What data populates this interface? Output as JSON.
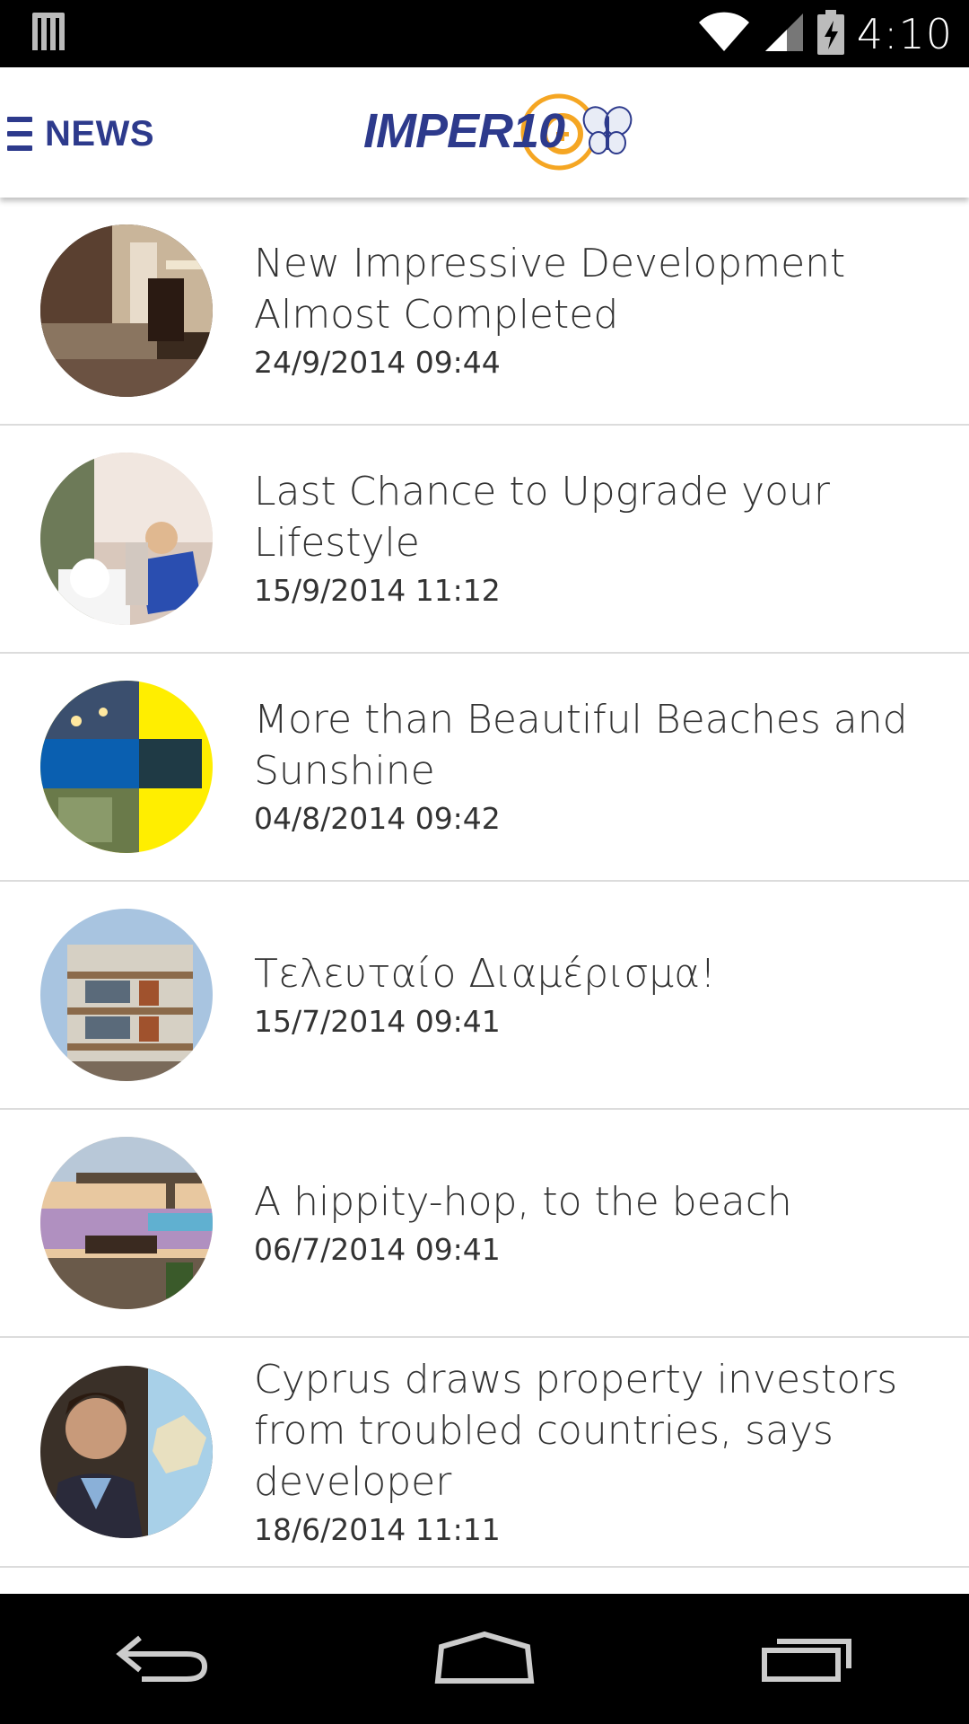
{
  "status_bar": {
    "time": "4:10",
    "icons": [
      "notification-bars-icon",
      "wifi-icon",
      "cell-signal-icon",
      "battery-charging-icon"
    ]
  },
  "app_bar": {
    "menu_label": "NEWS",
    "logo_text": "IMPER10"
  },
  "news": [
    {
      "title": "New Impressive Development Almost Completed",
      "date": "24/9/2014 09:44",
      "thumb": "living-room"
    },
    {
      "title": "Last Chance to Upgrade your Lifestyle",
      "date": "15/9/2014 11:12",
      "thumb": "woman-interior"
    },
    {
      "title": "More than Beautiful Beaches and Sunshine",
      "date": "04/8/2014 09:42",
      "thumb": "collage"
    },
    {
      "title": "Τελευταίο Διαμέρισμα!",
      "date": "15/7/2014 09:41",
      "thumb": "building"
    },
    {
      "title": "A hippity-hop, to the beach",
      "date": "06/7/2014 09:41",
      "thumb": "terrace"
    },
    {
      "title": "Cyprus draws property investors from troubled countries, says developer",
      "date": "18/6/2014 11:11",
      "thumb": "man-map"
    }
  ],
  "nav_bar": {
    "icons": [
      "back-icon",
      "home-icon",
      "recent-apps-icon"
    ]
  },
  "colors": {
    "brand_blue": "#2d3a8c",
    "logo_orange": "#f5a623"
  }
}
